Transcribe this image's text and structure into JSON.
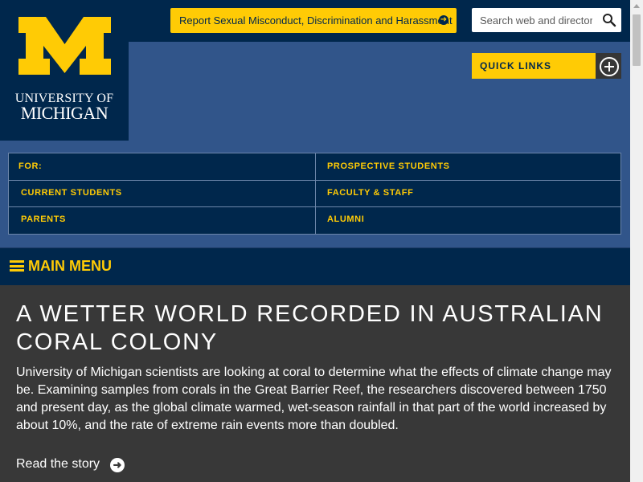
{
  "logo": {
    "letter": "M",
    "line1": "UNIVERSITY OF",
    "line2": "MICHIGAN"
  },
  "header": {
    "report_button": "Report Sexual Misconduct, Discrimination and Harassment",
    "search_placeholder": "Search web and directory",
    "quick_links": "QUICK LINKS"
  },
  "audience": {
    "for_label": "FOR:",
    "items": [
      "PROSPECTIVE STUDENTS",
      "CURRENT STUDENTS",
      "FACULTY & STAFF",
      "PARENTS",
      "ALUMNI"
    ]
  },
  "main_menu": {
    "label": "MAIN MENU"
  },
  "hero": {
    "title": "A WETTER WORLD RECORDED IN AUSTRALIAN CORAL COLONY",
    "body": "University of Michigan scientists are looking at coral to determine what the effects of climate change may be. Examining samples from corals in the Great Barrier Reef, the researchers discovered between 1750 and present day, as the global climate warmed, wet-season rainfall in that part of the world increased by about 10%, and the rate of extreme rain events more than doubled.",
    "link": "Read the story"
  },
  "colors": {
    "maize": "#ffcb05",
    "blue": "#00274c",
    "mid_blue": "#31558a",
    "hero_bg": "#383838"
  },
  "icons": [
    "search-icon",
    "arrow-right-icon",
    "plus-circle-icon",
    "hamburger-icon"
  ]
}
